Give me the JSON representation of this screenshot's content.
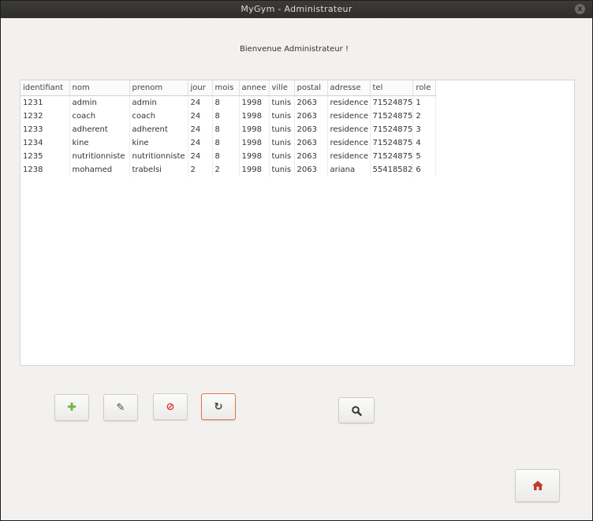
{
  "window": {
    "title": "MyGym - Administrateur",
    "close_glyph": "x"
  },
  "welcome": "Bienvenue Administrateur !",
  "table": {
    "columns": [
      "identifiant",
      "nom",
      "prenom",
      "jour",
      "mois",
      "annee",
      "ville",
      "postal",
      "adresse",
      "tel",
      "role"
    ],
    "rows": [
      [
        "1231",
        "admin",
        "admin",
        "24",
        "8",
        "1998",
        "tunis",
        "2063",
        "residence",
        "71524875",
        "1"
      ],
      [
        "1232",
        "coach",
        "coach",
        "24",
        "8",
        "1998",
        "tunis",
        "2063",
        "residence",
        "71524875",
        "2"
      ],
      [
        "1233",
        "adherent",
        "adherent",
        "24",
        "8",
        "1998",
        "tunis",
        "2063",
        "residence",
        "71524875",
        "3"
      ],
      [
        "1234",
        "kine",
        "kine",
        "24",
        "8",
        "1998",
        "tunis",
        "2063",
        "residence",
        "71524875",
        "4"
      ],
      [
        "1235",
        "nutritionniste",
        "nutritionniste",
        "24",
        "8",
        "1998",
        "tunis",
        "2063",
        "residence",
        "71524875",
        "5"
      ],
      [
        "1238",
        "mohamed",
        "trabelsi",
        "2",
        "2",
        "1998",
        "tunis",
        "2063",
        "ariana",
        "55418582",
        "6"
      ]
    ]
  },
  "toolbar": {
    "add": {
      "icon": "plus-icon",
      "glyph": "✚",
      "color": "#6fb43a"
    },
    "edit": {
      "icon": "pencil-icon",
      "glyph": "✎",
      "color": "#444444"
    },
    "delete": {
      "icon": "stop-icon",
      "glyph": "⊘",
      "color": "#d9302c"
    },
    "refresh": {
      "icon": "refresh-icon",
      "glyph": "↻",
      "color": "#444444"
    },
    "search": {
      "icon": "search-icon",
      "glyph": "🔍",
      "color": "#333333"
    },
    "home": {
      "icon": "home-icon",
      "glyph": "⌂",
      "color": "#c0392b"
    }
  }
}
